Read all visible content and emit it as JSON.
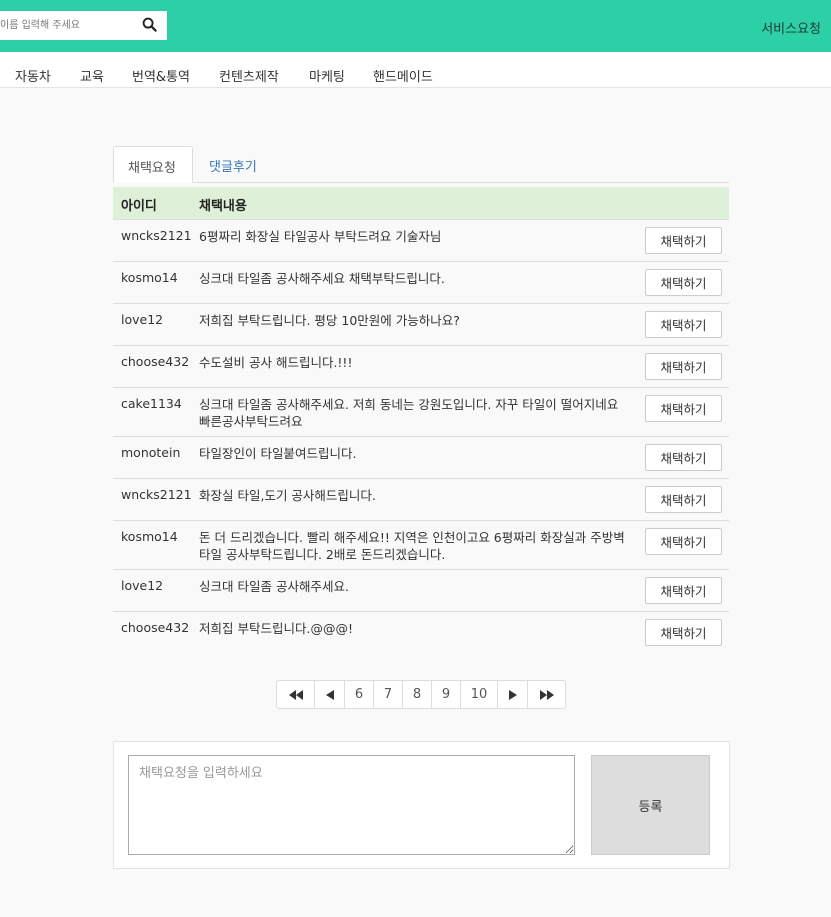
{
  "header": {
    "search_placeholder": "이름 입력해 주세요",
    "service_link": "서비스요청"
  },
  "categories": [
    "자동차",
    "교육",
    "번역&통역",
    "컨텐츠제작",
    "마케팅",
    "핸드메이드"
  ],
  "tabs": [
    {
      "label": "채택요청",
      "active": true
    },
    {
      "label": "댓글후기",
      "active": false
    }
  ],
  "table": {
    "headers": {
      "id": "아이디",
      "content": "채택내용"
    },
    "rows": [
      {
        "id": "wncks2121",
        "content": "6평짜리 화장실 타일공사 부탁드려요 기술자님",
        "button": "채택하기"
      },
      {
        "id": "kosmo14",
        "content": "싱크대 타일좀 공사해주세요 채택부탁드립니다.",
        "button": "채택하기"
      },
      {
        "id": "love12",
        "content": "저희집 부탁드립니다. 평당 10만원에 가능하나요?",
        "button": "채택하기"
      },
      {
        "id": "choose432",
        "content": "수도설비 공사 해드립니다.!!!",
        "button": "채택하기"
      },
      {
        "id": "cake1134",
        "content": "싱크대 타일좀 공사해주세요. 저희 동네는 강원도입니다. 자꾸 타일이 떨어지네요 빠른공사부탁드려요",
        "button": "채택하기"
      },
      {
        "id": "monotein",
        "content": "타일장인이 타일붙여드립니다.",
        "button": "채택하기"
      },
      {
        "id": "wncks2121",
        "content": "화장실 타일,도기 공사해드립니다.",
        "button": "채택하기"
      },
      {
        "id": "kosmo14",
        "content": "돈 더 드리겠습니다. 빨리 해주세요!! 지역은 인천이고요 6평짜리 화장실과 주방벽타일 공사부탁드립니다. 2배로 돈드리겠습니다.",
        "button": "채택하기"
      },
      {
        "id": "love12",
        "content": "싱크대 타일좀 공사해주세요.",
        "button": "채택하기"
      },
      {
        "id": "choose432",
        "content": "저희집 부탁드립니다.@@@!",
        "button": "채택하기"
      }
    ]
  },
  "pagination": {
    "first": "⏮",
    "prev": "◀",
    "pages": [
      "6",
      "7",
      "8",
      "9",
      "10"
    ],
    "next": "▶",
    "last": "⏭"
  },
  "compose": {
    "placeholder": "채택요청을 입력하세요",
    "submit_label": "등록"
  },
  "colors": {
    "header_bg": "#2ccfa6",
    "table_header_bg": "#dff0d8",
    "link": "#337ab7"
  }
}
